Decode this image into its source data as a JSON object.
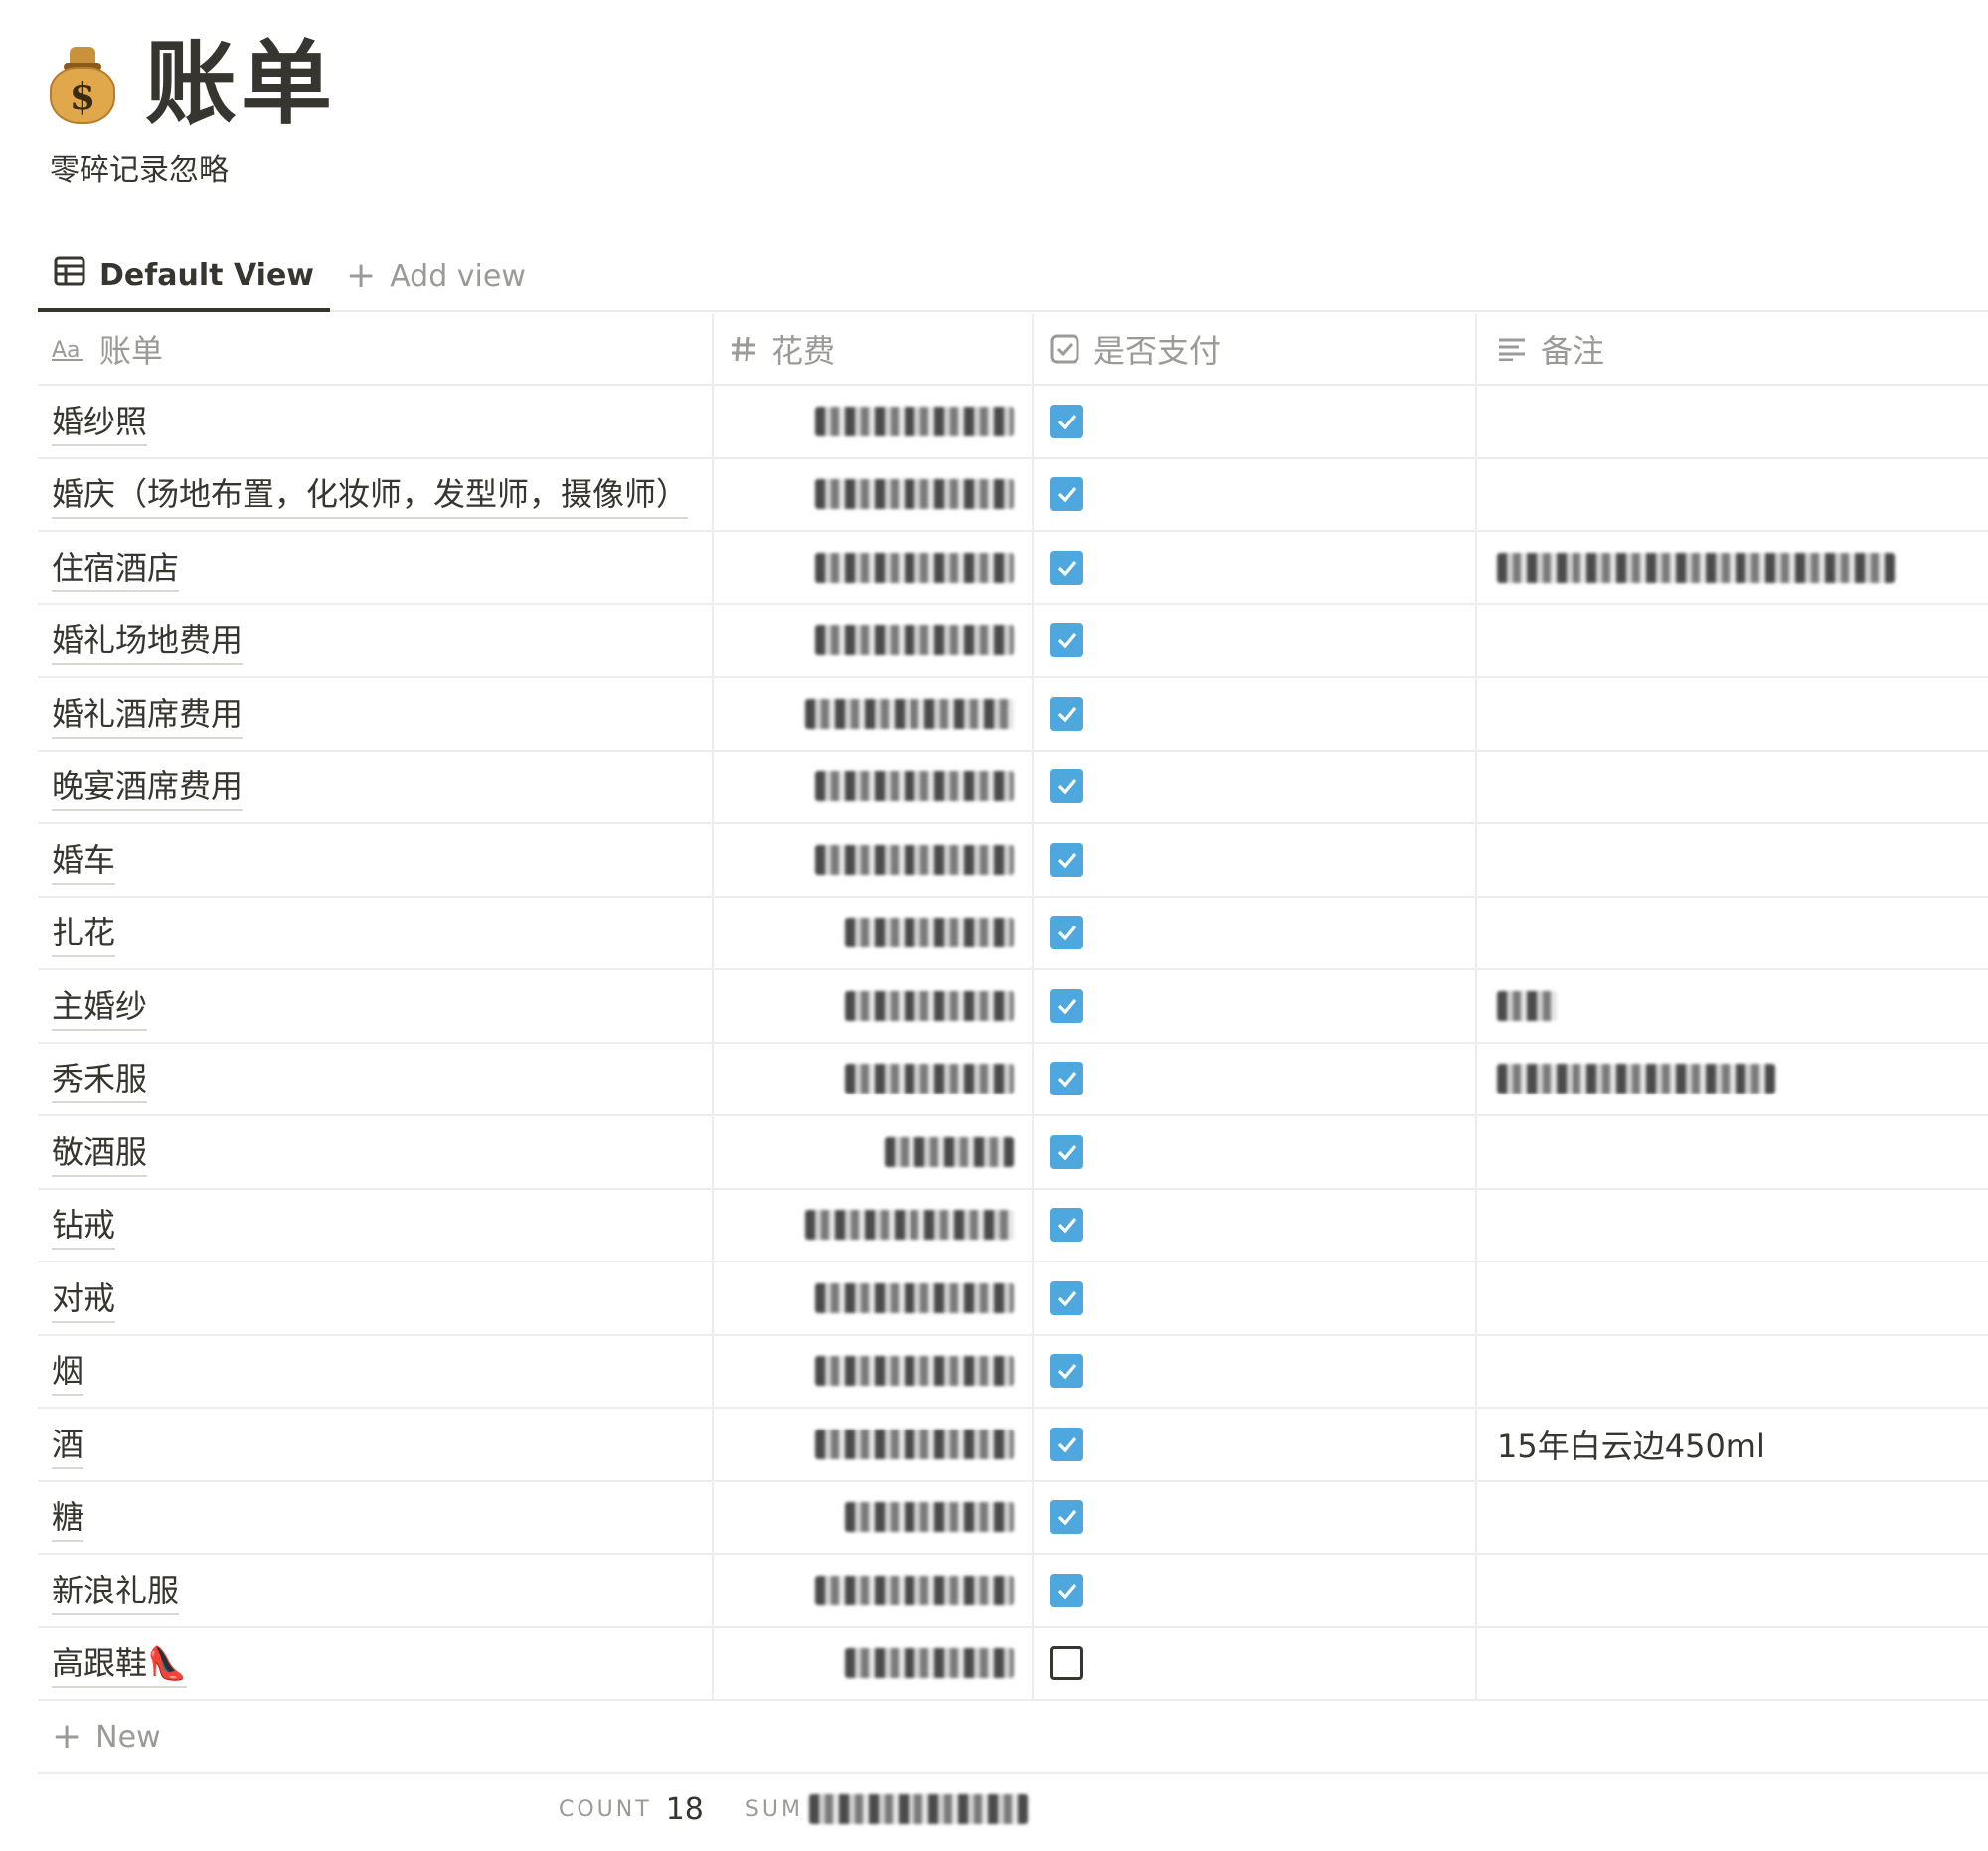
{
  "page": {
    "title": "账单",
    "icon": "money-bag-icon",
    "description": "零碎记录忽略"
  },
  "views": {
    "default_label": "Default View",
    "add_label": "Add view"
  },
  "columns": [
    {
      "label": "账单",
      "icon": "text-type-icon"
    },
    {
      "label": "花费",
      "icon": "number-hash-icon"
    },
    {
      "label": "是否支付",
      "icon": "checkbox-icon"
    },
    {
      "label": "备注",
      "icon": "text-lines-icon"
    }
  ],
  "rows": [
    {
      "name": "婚纱照",
      "paid": true,
      "note": ""
    },
    {
      "name": "婚庆（场地布置，化妆师，发型师，摄像师）",
      "paid": true,
      "note": ""
    },
    {
      "name": "住宿酒店",
      "paid": true,
      "note": ""
    },
    {
      "name": "婚礼场地费用",
      "paid": true,
      "note": ""
    },
    {
      "name": "婚礼酒席费用",
      "paid": true,
      "note": ""
    },
    {
      "name": "晚宴酒席费用",
      "paid": true,
      "note": ""
    },
    {
      "name": "婚车",
      "paid": true,
      "note": ""
    },
    {
      "name": "扎花",
      "paid": true,
      "note": ""
    },
    {
      "name": "主婚纱",
      "paid": true,
      "note": ""
    },
    {
      "name": "秀禾服",
      "paid": true,
      "note": ""
    },
    {
      "name": "敬酒服",
      "paid": true,
      "note": ""
    },
    {
      "name": "钻戒",
      "paid": true,
      "note": ""
    },
    {
      "name": "对戒",
      "paid": true,
      "note": ""
    },
    {
      "name": "烟",
      "paid": true,
      "note": ""
    },
    {
      "name": "酒",
      "paid": true,
      "note": "15年白云边450ml"
    },
    {
      "name": "糖",
      "paid": true,
      "note": ""
    },
    {
      "name": "新浪礼服",
      "paid": true,
      "note": ""
    },
    {
      "name": "高跟鞋👠",
      "paid": false,
      "note": ""
    }
  ],
  "new_label": "New",
  "footer": {
    "count_label": "COUNT",
    "count_value": "18",
    "sum_label": "SUM"
  },
  "colors": {
    "checkbox_checked": "#4ea8de",
    "text": "#37352f",
    "muted": "#9b9a97"
  }
}
